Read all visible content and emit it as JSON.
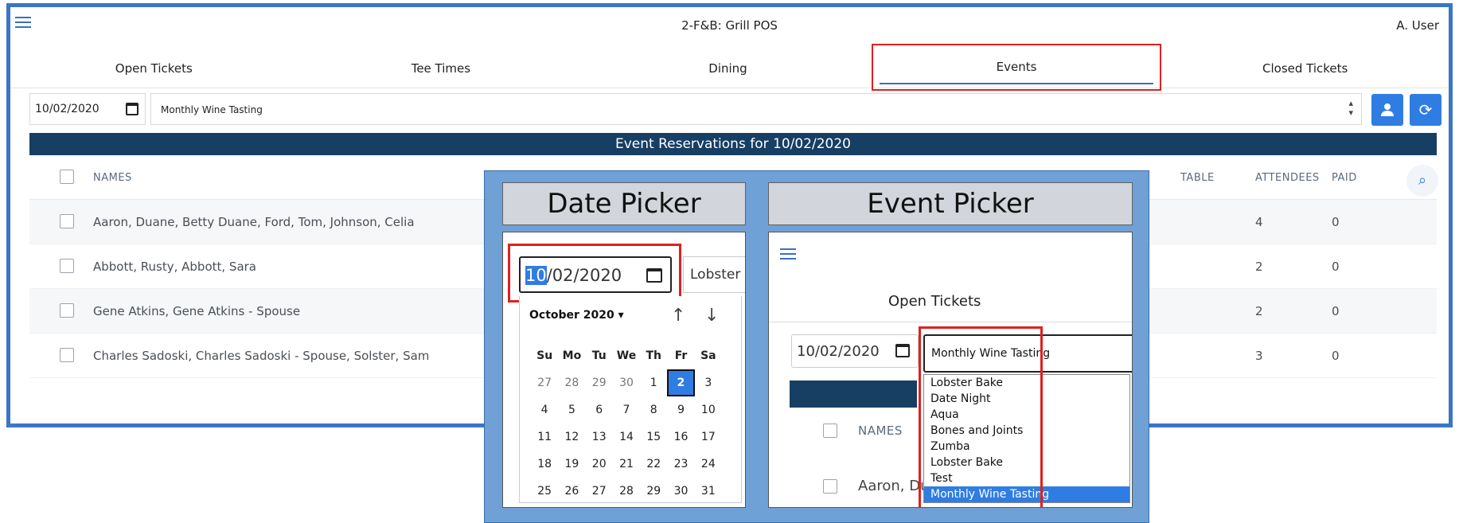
{
  "app": {
    "title": "2-F&B: Grill POS",
    "user": "A. User"
  },
  "tabs": [
    {
      "label": "Open Tickets"
    },
    {
      "label": "Tee Times"
    },
    {
      "label": "Dining"
    },
    {
      "label": "Events"
    },
    {
      "label": "Closed Tickets"
    }
  ],
  "active_tab": "Events",
  "filters": {
    "date": "10/02/2020",
    "event": "Monthly Wine Tasting"
  },
  "banner": "Event Reservations for 10/02/2020",
  "table": {
    "headers": {
      "names": "NAMES",
      "table": "TABLE",
      "attendees": "ATTENDEES",
      "paid": "PAID"
    },
    "rows": [
      {
        "names": "Aaron, Duane, Betty Duane, Ford, Tom, Johnson, Celia",
        "attendees": "4",
        "paid": "0"
      },
      {
        "names": "Abbott, Rusty, Abbott, Sara",
        "attendees": "2",
        "paid": "0"
      },
      {
        "names": "Gene Atkins, Gene Atkins - Spouse",
        "attendees": "2",
        "paid": "0"
      },
      {
        "names": "Charles Sadoski, Charles Sadoski - Spouse, Solster, Sam",
        "attendees": "3",
        "paid": "0"
      }
    ]
  },
  "overlay": {
    "date_picker_title": "Date Picker",
    "event_picker_title": "Event Picker",
    "date_day": "10",
    "date_rest": "/02/2020",
    "partial_event": "Lobster B",
    "calendar": {
      "month": "October 2020 ▾",
      "days_of_week": [
        "Su",
        "Mo",
        "Tu",
        "We",
        "Th",
        "Fr",
        "Sa"
      ],
      "weeks": [
        [
          "27",
          "28",
          "29",
          "30",
          "1",
          "2",
          "3"
        ],
        [
          "4",
          "5",
          "6",
          "7",
          "8",
          "9",
          "10"
        ],
        [
          "11",
          "12",
          "13",
          "14",
          "15",
          "16",
          "17"
        ],
        [
          "18",
          "19",
          "20",
          "21",
          "22",
          "23",
          "24"
        ],
        [
          "25",
          "26",
          "27",
          "28",
          "29",
          "30",
          "31"
        ]
      ],
      "selected": "2"
    },
    "event_panel": {
      "tab": "Open Tickets",
      "date": "10/02/2020",
      "event_value": "Monthly Wine Tasting",
      "options": [
        "Lobster Bake",
        "Date Night",
        "Aqua",
        "Bones and Joints",
        "Zumba",
        "Lobster Bake",
        "Test",
        "Monthly Wine Tasting"
      ],
      "selected_option": "Monthly Wine Tasting",
      "names_header": "NAMES",
      "partial_name": "Aaron, Du"
    }
  },
  "colors": {
    "accent": "#2f7de3",
    "banner": "#173e63",
    "highlight_box": "#e02020",
    "frame": "#3a76c4"
  }
}
